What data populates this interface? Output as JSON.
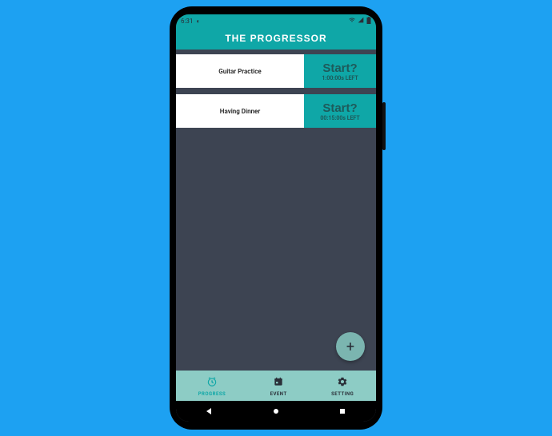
{
  "status": {
    "time": "6:31",
    "icon": "◐"
  },
  "app": {
    "title": "THE PROGRESSOR"
  },
  "tasks": [
    {
      "name": "Guitar Practice",
      "action": "Start?",
      "remaining": "1:00:00s LEFT"
    },
    {
      "name": "Having Dinner",
      "action": "Start?",
      "remaining": "00:15:00s LEFT"
    }
  ],
  "fab": {
    "label": "+"
  },
  "nav": {
    "items": [
      {
        "label": "PROGRESS"
      },
      {
        "label": "EVENT"
      },
      {
        "label": "SETTING"
      }
    ]
  }
}
